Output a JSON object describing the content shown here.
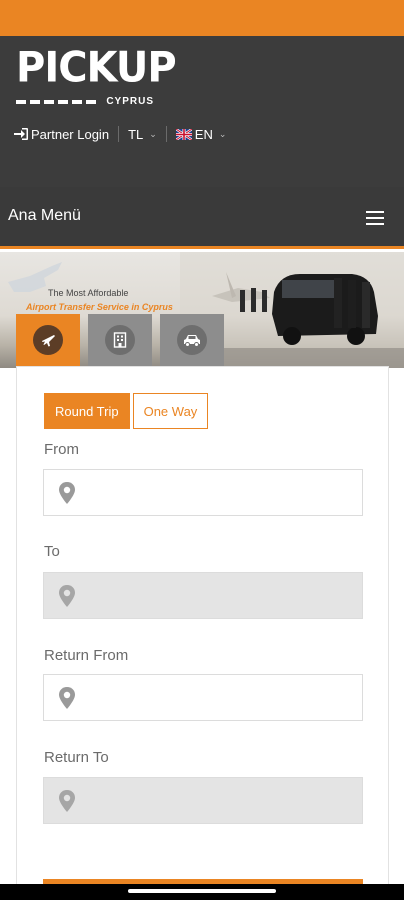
{
  "brand": {
    "logo_word": "PICKUP",
    "logo_sub": "CYPRUS",
    "accent": "#ea8523",
    "header_bg": "#3c3c3c"
  },
  "header": {
    "partner_login": "Partner Login",
    "currency": "TL",
    "language": "EN",
    "login_icon": "sign-in-icon",
    "flag_icon": "uk-flag-icon"
  },
  "menu": {
    "title": "Ana Menü",
    "menu_icon": "hamburger-icon"
  },
  "banner": {
    "line1": "The Most Affordable",
    "line2": "Airport Transfer Service in Cyprus"
  },
  "tabs": [
    {
      "icon": "plane-icon",
      "active": true
    },
    {
      "icon": "building-icon",
      "active": false
    },
    {
      "icon": "car-icon",
      "active": false
    }
  ],
  "form": {
    "trip_types": [
      "Round Trip",
      "One Way"
    ],
    "selected_trip_type": "Round Trip",
    "fields": [
      {
        "label": "From",
        "value": "",
        "disabled": false
      },
      {
        "label": "To",
        "value": "",
        "disabled": true
      },
      {
        "label": "Return From",
        "value": "",
        "disabled": false
      },
      {
        "label": "Return To",
        "value": "",
        "disabled": true
      }
    ]
  }
}
